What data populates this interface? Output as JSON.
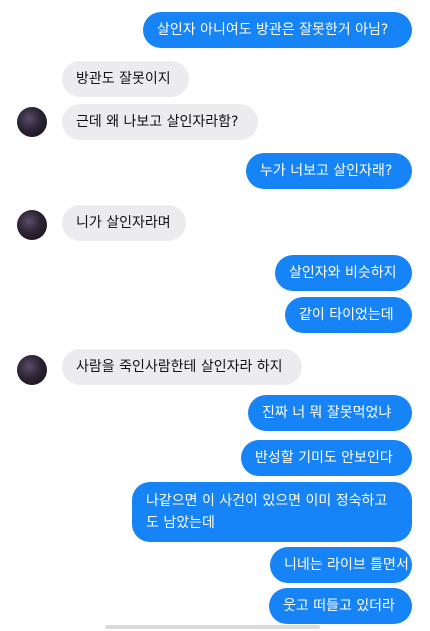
{
  "messages": [
    {
      "side": "out",
      "text": "살인자 아니여도 방관은 잘못한거 아님?"
    },
    {
      "side": "in",
      "text": "방관도 잘못이지"
    },
    {
      "side": "in",
      "text": "근데 왜 나보고 살인자라함?"
    },
    {
      "side": "out",
      "text": "누가 너보고 살인자래?"
    },
    {
      "side": "in",
      "text": "니가 살인자라며"
    },
    {
      "side": "out",
      "text": "살인자와 비슷하지"
    },
    {
      "side": "out",
      "text": "같이 타이었는데"
    },
    {
      "side": "in",
      "text": "사람을 죽인사람한테 살인자라 하지"
    },
    {
      "side": "out",
      "text": "진짜 너 뭐 잘못먹었냐"
    },
    {
      "side": "out",
      "text": "반성할 기미도 안보인다"
    },
    {
      "side": "out",
      "text": "나같으면 이 사건이 있으면 이미 정숙하고 도 남았는데"
    },
    {
      "side": "out",
      "text": "니네는 라이브 틀면서"
    },
    {
      "side": "out",
      "text": "웃고 떠들고 있더라"
    }
  ],
  "colors": {
    "outgoing": "#1683f7",
    "incoming": "#ececee",
    "background": "#ffffff"
  }
}
